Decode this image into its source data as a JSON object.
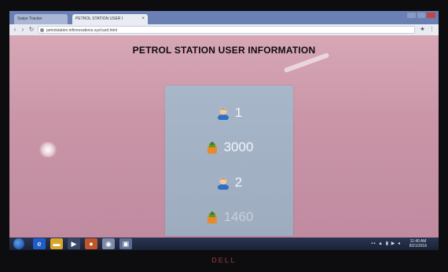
{
  "browser": {
    "tabs": [
      {
        "label": "Swipe Tracker"
      },
      {
        "label": "PETROL STATION USER I"
      }
    ],
    "tab_close_glyph": "×",
    "address": "petrolstation.infinnovations.xyz/card.html"
  },
  "page": {
    "title": "PETROL STATION USER INFORMATION",
    "rows": [
      {
        "icon": "user-icon",
        "value": "1"
      },
      {
        "icon": "fuel-money-icon",
        "value": "3000"
      },
      {
        "icon": "user-icon",
        "value": "2"
      },
      {
        "icon": "fuel-money-icon",
        "value": "1460"
      }
    ]
  },
  "taskbar": {
    "clock_time": "11:40 AM",
    "clock_date": "8/21/2016"
  },
  "monitor": {
    "brand": "DELL"
  },
  "colors": {
    "page_bg": "#c994a7",
    "card_bg": "#a3b1c5",
    "value_text": "#f2f4f8",
    "tab_bar": "#6a7fb3",
    "taskbar": "#1f2740"
  }
}
